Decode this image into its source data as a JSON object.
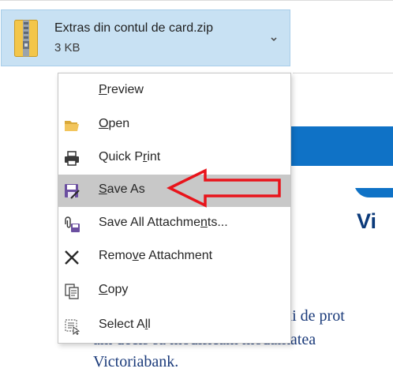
{
  "attachment": {
    "file_name": "Extras din contul de card.zip",
    "file_size": "3 KB",
    "icon": "zip-file-icon"
  },
  "context_menu": {
    "items": [
      {
        "pre": "",
        "mnemonic": "P",
        "post": "review",
        "icon": "none",
        "highlighted": false
      },
      {
        "pre": "",
        "mnemonic": "O",
        "post": "pen",
        "icon": "folder-open-icon",
        "highlighted": false
      },
      {
        "pre": "Quick P",
        "mnemonic": "r",
        "post": "int",
        "icon": "printer-icon",
        "highlighted": false
      },
      {
        "pre": "",
        "mnemonic": "S",
        "post": "ave As",
        "icon": "save-as-icon",
        "highlighted": true
      },
      {
        "pre": "Save All Attachme",
        "mnemonic": "n",
        "post": "ts...",
        "icon": "save-all-attachments-icon",
        "highlighted": false
      },
      {
        "pre": "Remo",
        "mnemonic": "v",
        "post": "e Attachment",
        "icon": "remove-x-icon",
        "highlighted": false
      },
      {
        "pre": "",
        "mnemonic": "C",
        "post": "opy",
        "icon": "copy-icon",
        "highlighted": false
      },
      {
        "pre": "Select A",
        "mnemonic": "l",
        "post": "l",
        "icon": "select-all-icon",
        "highlighted": false
      }
    ]
  },
  "email_body": {
    "logo_text": "Vi",
    "line1": "lului de prot",
    "line2": "am decis să modificăm modalitatea",
    "line3": "Victoriabank."
  },
  "colors": {
    "attachment_bg": "#c8e1f3",
    "highlight_bg": "#c8c8c8",
    "annotation_red": "#e8141b",
    "brand_blue": "#0f72c6"
  }
}
